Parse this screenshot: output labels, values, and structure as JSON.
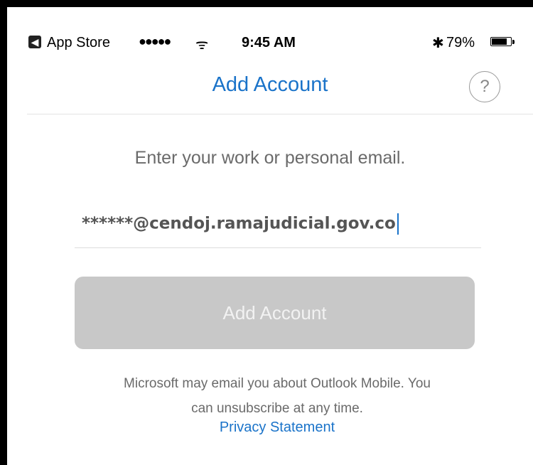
{
  "status_bar": {
    "back_badge": "◀",
    "carrier": "App Store",
    "signal": "●●●●●",
    "wifi": "ᯤ",
    "time": "9:45 AM",
    "bluetooth": "✱",
    "battery_percent": "79%",
    "battery_level": 0.79
  },
  "nav": {
    "title": "Add Account",
    "help_label": "?"
  },
  "form": {
    "instruction": "Enter your work or personal email.",
    "email_value": "******@cendoj.ramajudicial.gov.co",
    "submit_label": "Add Account",
    "disclaimer_line1": "Microsoft may email you about Outlook Mobile. You",
    "disclaimer_line2": "can unsubscribe at any time.",
    "privacy_label": "Privacy Statement"
  },
  "colors": {
    "accent": "#1a73c9",
    "button_disabled": "#c8c8c8"
  }
}
